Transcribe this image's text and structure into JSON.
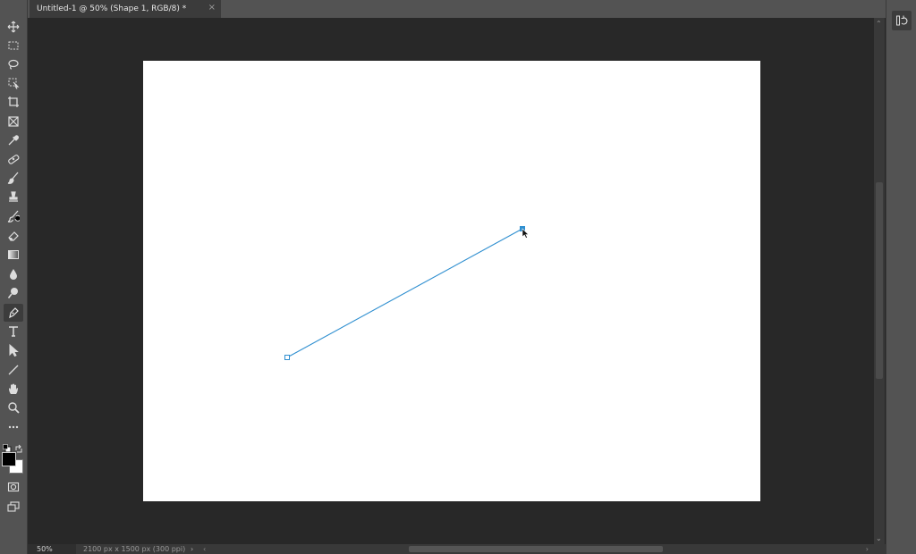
{
  "document": {
    "tab_title": "Untitled-1 @ 50% (Shape 1, RGB/8) *",
    "close_glyph": "×"
  },
  "status": {
    "zoom": "50%",
    "doc_info": "2100 px x 1500 px (300 ppi)",
    "info_arrow": "›"
  },
  "tools": [
    "move-tool-icon",
    "marquee-tool-icon",
    "lasso-tool-icon",
    "object-select-tool-icon",
    "crop-tool-icon",
    "frame-tool-icon",
    "eyedropper-tool-icon",
    "healing-brush-tool-icon",
    "brush-tool-icon",
    "clone-stamp-tool-icon",
    "history-brush-tool-icon",
    "eraser-tool-icon",
    "gradient-tool-icon",
    "blur-tool-icon",
    "dodge-tool-icon",
    "pen-tool-icon",
    "type-tool-icon",
    "path-select-tool-icon",
    "line-tool-icon",
    "hand-tool-icon",
    "zoom-tool-icon",
    "more-tools-icon"
  ],
  "active_tool": "pen-tool-icon",
  "colors": {
    "foreground": "#000000",
    "background": "#ffffff",
    "path_stroke": "#2f8fd0",
    "ui_panel": "#535353",
    "workspace": "#282828"
  }
}
